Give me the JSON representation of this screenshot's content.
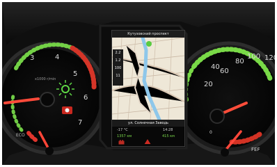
{
  "image": {
    "subject": "Car instrument cluster with central navigation screen",
    "colors": {
      "housing": "#0b0b0b",
      "green_scale": "#74d143",
      "red_scale": "#e33a2a",
      "needle": "#ff3c2e",
      "map": "#eee7d7",
      "route": "#8ec7ea"
    }
  },
  "left_gauge": {
    "labels": [
      "3",
      "4",
      "5",
      "6",
      "7"
    ],
    "bottom_left_label": "ECO",
    "brand_text": "x1000 r/min"
  },
  "navigation": {
    "top_street": "Кутузовский проспект",
    "left_distances": [
      "2.2",
      "1.2",
      "100",
      "11"
    ],
    "bottom_street": "ул. Солнечная Заводь",
    "temp": "-17 °C",
    "time": "14:28",
    "distance_left": "1357 км",
    "distance_right": "415 км"
  },
  "right_gauge": {
    "labels": [
      "20",
      "40",
      "60",
      "80",
      "100",
      "120"
    ],
    "partial_label": "0",
    "indicator_text": "FEF"
  }
}
